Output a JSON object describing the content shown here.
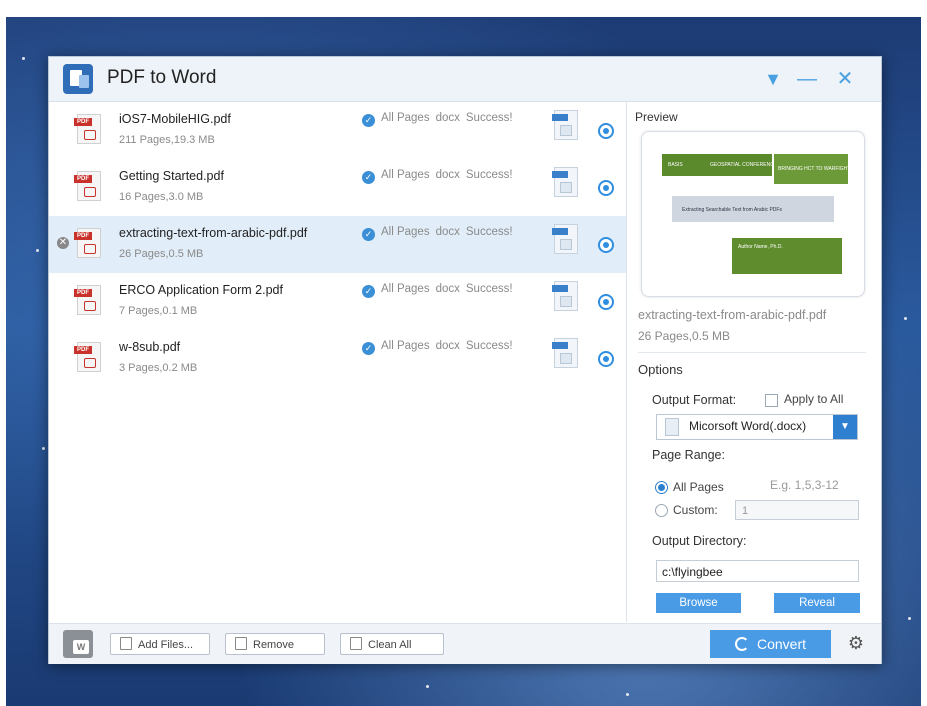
{
  "window": {
    "title": "PDF to Word"
  },
  "files": [
    {
      "name": "iOS7-MobileHIG.pdf",
      "meta": "211 Pages,19.3 MB",
      "pages": "All Pages",
      "format": "docx",
      "status": "Success!"
    },
    {
      "name": "Getting Started.pdf",
      "meta": "16 Pages,3.0 MB",
      "pages": "All Pages",
      "format": "docx",
      "status": "Success!"
    },
    {
      "name": "extracting-text-from-arabic-pdf.pdf",
      "meta": "26 Pages,0.5 MB",
      "pages": "All Pages",
      "format": "docx",
      "status": "Success!"
    },
    {
      "name": "ERCO Application Form 2.pdf",
      "meta": "7 Pages,0.1 MB",
      "pages": "All Pages",
      "format": "docx",
      "status": "Success!"
    },
    {
      "name": "w-8sub.pdf",
      "meta": "3 Pages,0.2 MB",
      "pages": "All Pages",
      "format": "docx",
      "status": "Success!"
    }
  ],
  "preview": {
    "label": "Preview",
    "file_name": "extracting-text-from-arabic-pdf.pdf",
    "file_meta": "26 Pages,0.5 MB",
    "slide_text": {
      "basis": "BASIS",
      "conference": "GEOSPATIAL CONFERENCE",
      "bringing": "BRINGING HCT TO WARFIGHTER",
      "band": "Extracting Searchable Text from Arabic PDFs",
      "author": "Author Name, Ph.D."
    }
  },
  "options": {
    "title": "Options",
    "output_format_label": "Output Format:",
    "apply_all_label": "Apply to All",
    "format_value": "Micorsoft Word(.docx)",
    "page_range_label": "Page Range:",
    "all_pages_label": "All Pages",
    "example_hint": "E.g. 1,5,3-12",
    "custom_label": "Custom:",
    "custom_value": "1",
    "output_dir_label": "Output Directory:",
    "output_dir_value": "c:\\flyingbee",
    "browse_label": "Browse",
    "reveal_label": "Reveal"
  },
  "bottom": {
    "add_files": "Add Files...",
    "remove": "Remove",
    "clean_all": "Clean All",
    "convert": "Convert"
  },
  "colors": {
    "accent": "#4a9be6",
    "pdf_red": "#c9312b",
    "selected_row": "#e1edf8"
  }
}
